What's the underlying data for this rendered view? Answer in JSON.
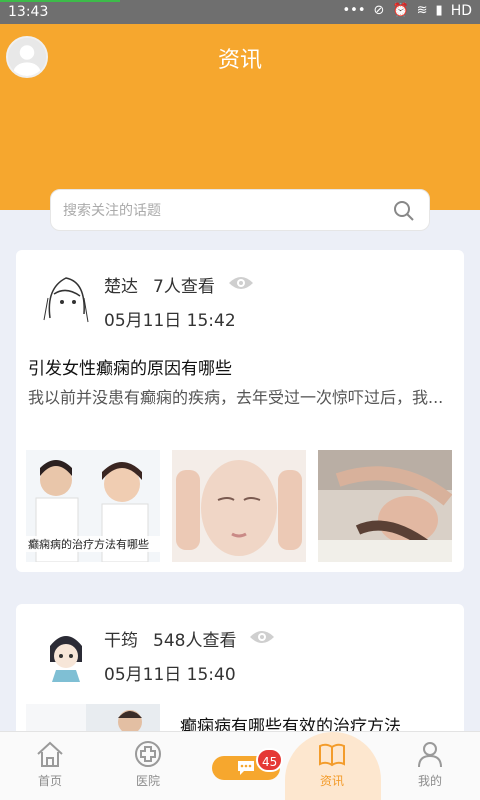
{
  "status_bar": {
    "time": "13:43",
    "network": "HD",
    "progress": 0.25
  },
  "header": {
    "title": "资讯"
  },
  "search": {
    "placeholder": "搜索关注的话题"
  },
  "posts": [
    {
      "author": "楚达",
      "views": "7人查看",
      "date": "05月11日 15:42",
      "title": "引发女性癫痫的原因有哪些",
      "excerpt": "我以前并没患有癫痫的疾病，去年受过一次惊吓过后，我...",
      "thumb_caption": "癫痫病的治疗方法有哪些"
    },
    {
      "author": "干筠",
      "views": "548人查看",
      "date": "05月11日 15:40",
      "title": "癫痫病有哪些有效的治疗方法"
    }
  ],
  "bottom_nav": {
    "items": [
      {
        "label": "首页",
        "icon": "home-icon"
      },
      {
        "label": "医院",
        "icon": "hospital-icon"
      },
      {
        "label": "资讯",
        "icon": "news-book-icon",
        "active": true
      },
      {
        "label": "我的",
        "icon": "person-icon"
      }
    ],
    "chat_badge": "45"
  },
  "colors": {
    "accent": "#f6a72e",
    "badge": "#e53935"
  }
}
